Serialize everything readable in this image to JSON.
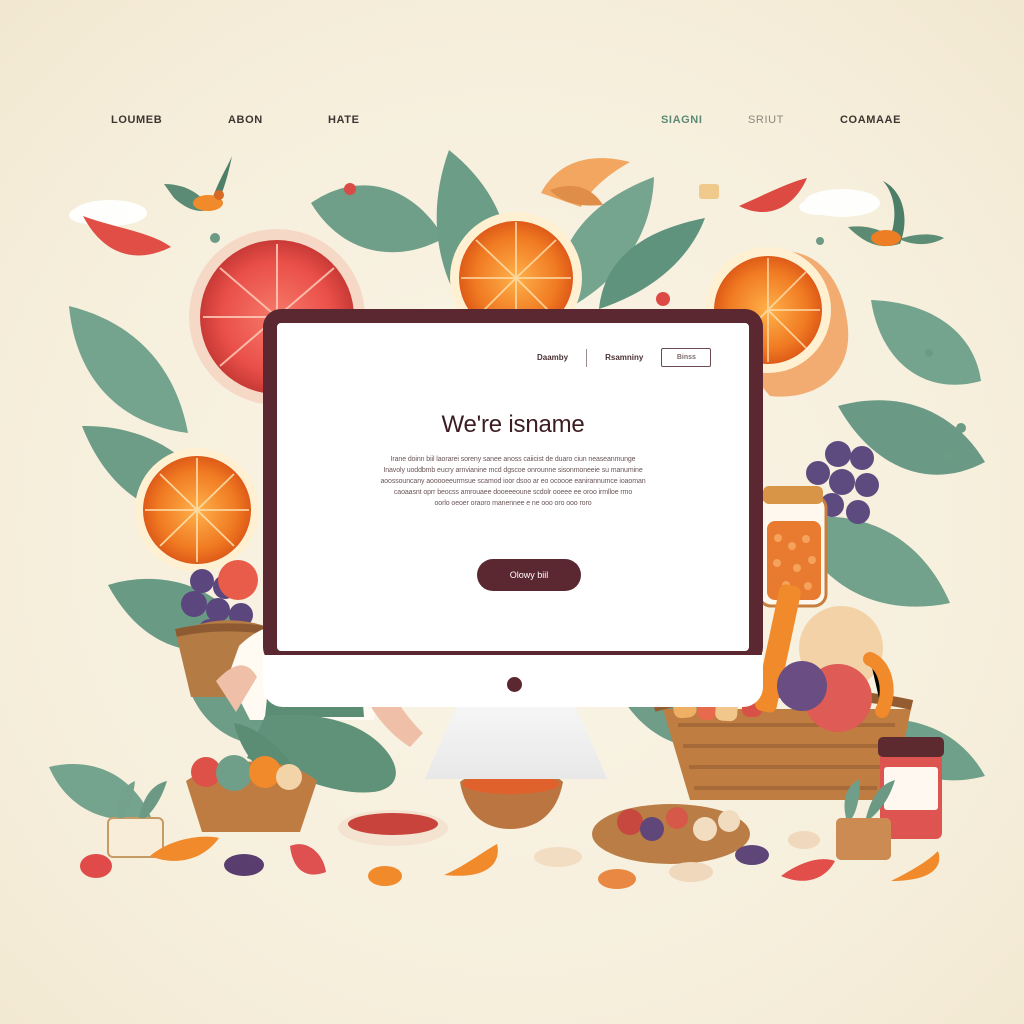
{
  "nav": {
    "items": [
      "LOUMEB",
      "ABON",
      "HATE",
      "SIAGNI",
      "SRIUT",
      "COAMAAE"
    ]
  },
  "screen": {
    "nav": {
      "link1": "Daamby",
      "link2": "Rsamniny",
      "button": "Binss"
    },
    "title": "We're isname",
    "body": [
      "Irane doinn biil laorarei soreny sanee anoss caiicist de duaro ciun neaseanmunge",
      "Inavoly uoddbmb eucry arnvianine mcd dgscoe onrounne sisonmoneeie su manumine",
      "aoossouncany aooooeeurmsue scamod ioor dsoo ar eo ocoooe eanirannumce ioaoman",
      "caoaasnt oprr beocss amrouaee dooeeeoune scdolr ooeee ee oroo irmlloe rmo",
      "oorlo oeoer oraoro manennee e ne ooo oro ooo roro"
    ],
    "button": "Olowy biil"
  },
  "colors": {
    "accent": "#5b2831",
    "background": "#f7f0df",
    "leaf": "#72a18c",
    "orange": "#f08a2b",
    "red": "#d64b45"
  },
  "icons": [
    "monitor-icon",
    "apple-logo-icon",
    "bird-icon",
    "orange-slice-icon",
    "basket-icon",
    "jar-icon"
  ]
}
